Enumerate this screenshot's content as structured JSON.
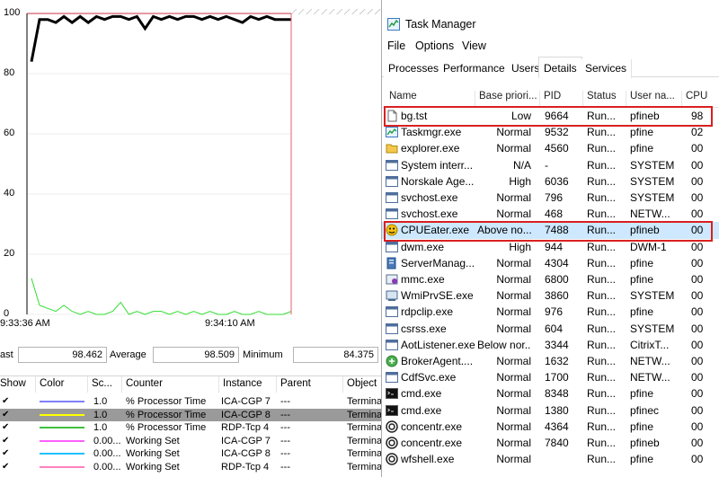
{
  "perfmon": {
    "y_ticks": [
      "100",
      "80",
      "60",
      "40",
      "20",
      "0"
    ],
    "x_start": "9:33:36 AM",
    "x_mid": "9:34:10 AM",
    "stats": {
      "last_label": "ast",
      "last_value": "98.462",
      "average_label": "Average",
      "average_value": "98.509",
      "minimum_label": "Minimum",
      "minimum_value": "84.375"
    },
    "legend_headers": {
      "show": "Show",
      "color": "Color",
      "scale": "Sc...",
      "counter": "Counter",
      "instance": "Instance",
      "parent": "Parent",
      "object": "Object"
    },
    "legend_rows": [
      {
        "scale": "1.0",
        "counter": "% Processor Time",
        "instance": "ICA-CGP 7",
        "parent": "---",
        "object": "Termina",
        "color": "#8080ff"
      },
      {
        "scale": "1.0",
        "counter": "% Processor Time",
        "instance": "ICA-CGP 8",
        "parent": "---",
        "object": "Termina",
        "color": "#ffff00"
      },
      {
        "scale": "1.0",
        "counter": "% Processor Time",
        "instance": "RDP-Tcp 4",
        "parent": "---",
        "object": "Termina",
        "color": "#40c040"
      },
      {
        "scale": "0.00...",
        "counter": "Working Set",
        "instance": "ICA-CGP 7",
        "parent": "---",
        "object": "Termina",
        "color": "#ff60ff"
      },
      {
        "scale": "0.00...",
        "counter": "Working Set",
        "instance": "ICA-CGP 8",
        "parent": "---",
        "object": "Termina",
        "color": "#20c0ff"
      },
      {
        "scale": "0.00...",
        "counter": "Working Set",
        "instance": "RDP-Tcp 4",
        "parent": "---",
        "object": "Termina",
        "color": "#ff80c0"
      }
    ],
    "series": {
      "cpu_black": [
        84,
        98,
        98,
        97,
        99,
        97,
        99,
        97,
        99,
        98,
        99,
        99,
        98,
        99,
        95,
        99,
        98,
        99,
        98,
        99,
        99,
        98,
        99,
        98,
        99,
        98,
        97,
        99,
        98,
        99,
        98,
        98,
        98
      ],
      "cpu_green": [
        12,
        3,
        2,
        1,
        3,
        1,
        0,
        1,
        0,
        0,
        1,
        4,
        0,
        1,
        0,
        1,
        1,
        0,
        1,
        0,
        1,
        0,
        1,
        0,
        0,
        1,
        0,
        0,
        1,
        0,
        0,
        0,
        1
      ]
    },
    "colors": {
      "line_main": "#000000",
      "line_green": "#33dd33",
      "cursor": "#e06070",
      "grid_top": "#cc3344"
    }
  },
  "taskmgr": {
    "title": "Task Manager",
    "menu": [
      "File",
      "Options",
      "View"
    ],
    "tabs": [
      "Processes",
      "Performance",
      "Users",
      "Details",
      "Services"
    ],
    "active_tab": "Details",
    "columns": [
      "Name",
      "Base priori...",
      "PID",
      "Status",
      "User na...",
      "CPU"
    ],
    "processes": [
      {
        "name": "bg.tst",
        "priority": "Low",
        "pid": "9664",
        "status": "Run...",
        "user": "pfineb",
        "cpu": "98",
        "icon": "document-icon"
      },
      {
        "name": "Taskmgr.exe",
        "priority": "Normal",
        "pid": "9532",
        "status": "Run...",
        "user": "pfine",
        "cpu": "02",
        "icon": "taskmgr-icon"
      },
      {
        "name": "explorer.exe",
        "priority": "Normal",
        "pid": "4560",
        "status": "Run...",
        "user": "pfine",
        "cpu": "00",
        "icon": "folder-icon"
      },
      {
        "name": "System interr...",
        "priority": "N/A",
        "pid": "-",
        "status": "Run...",
        "user": "SYSTEM",
        "cpu": "00",
        "icon": "window-icon"
      },
      {
        "name": "Norskale Age...",
        "priority": "High",
        "pid": "6036",
        "status": "Run...",
        "user": "SYSTEM",
        "cpu": "00",
        "icon": "window-icon"
      },
      {
        "name": "svchost.exe",
        "priority": "Normal",
        "pid": "796",
        "status": "Run...",
        "user": "SYSTEM",
        "cpu": "00",
        "icon": "window-icon"
      },
      {
        "name": "svchost.exe",
        "priority": "Normal",
        "pid": "468",
        "status": "Run...",
        "user": "NETW...",
        "cpu": "00",
        "icon": "window-icon"
      },
      {
        "name": "CPUEater.exe",
        "priority": "Above no...",
        "pid": "7488",
        "status": "Run...",
        "user": "pfineb",
        "cpu": "00",
        "icon": "smiley-icon"
      },
      {
        "name": "dwm.exe",
        "priority": "High",
        "pid": "944",
        "status": "Run...",
        "user": "DWM-1",
        "cpu": "00",
        "icon": "window-icon"
      },
      {
        "name": "ServerManag...",
        "priority": "Normal",
        "pid": "4304",
        "status": "Run...",
        "user": "pfine",
        "cpu": "00",
        "icon": "server-icon"
      },
      {
        "name": "mmc.exe",
        "priority": "Normal",
        "pid": "6800",
        "status": "Run...",
        "user": "pfine",
        "cpu": "00",
        "icon": "mmc-icon"
      },
      {
        "name": "WmiPrvSE.exe",
        "priority": "Normal",
        "pid": "3860",
        "status": "Run...",
        "user": "SYSTEM",
        "cpu": "00",
        "icon": "wmi-icon"
      },
      {
        "name": "rdpclip.exe",
        "priority": "Normal",
        "pid": "976",
        "status": "Run...",
        "user": "pfine",
        "cpu": "00",
        "icon": "window-icon"
      },
      {
        "name": "csrss.exe",
        "priority": "Normal",
        "pid": "604",
        "status": "Run...",
        "user": "SYSTEM",
        "cpu": "00",
        "icon": "window-icon"
      },
      {
        "name": "AotListener.exe",
        "priority": "Below nor...",
        "pid": "3344",
        "status": "Run...",
        "user": "CitrixT...",
        "cpu": "00",
        "icon": "window-icon"
      },
      {
        "name": "BrokerAgent....",
        "priority": "Normal",
        "pid": "1632",
        "status": "Run...",
        "user": "NETW...",
        "cpu": "00",
        "icon": "broker-icon"
      },
      {
        "name": "CdfSvc.exe",
        "priority": "Normal",
        "pid": "1700",
        "status": "Run...",
        "user": "NETW...",
        "cpu": "00",
        "icon": "window-icon"
      },
      {
        "name": "cmd.exe",
        "priority": "Normal",
        "pid": "8348",
        "status": "Run...",
        "user": "pfine",
        "cpu": "00",
        "icon": "cmd-icon"
      },
      {
        "name": "cmd.exe",
        "priority": "Normal",
        "pid": "1380",
        "status": "Run...",
        "user": "pfinec",
        "cpu": "00",
        "icon": "cmd-icon"
      },
      {
        "name": "concentr.exe",
        "priority": "Normal",
        "pid": "4364",
        "status": "Run...",
        "user": "pfine",
        "cpu": "00",
        "icon": "citrix-icon"
      },
      {
        "name": "concentr.exe",
        "priority": "Normal",
        "pid": "7840",
        "status": "Run...",
        "user": "pfineb",
        "cpu": "00",
        "icon": "citrix-icon"
      },
      {
        "name": "wfshell.exe",
        "priority": "Normal",
        "pid": "",
        "status": "Run...",
        "user": "pfine",
        "cpu": "00",
        "icon": "citrix-icon"
      }
    ],
    "colors": {
      "selected_row": "#cde8ff",
      "highlight_box": "#d92020"
    }
  }
}
